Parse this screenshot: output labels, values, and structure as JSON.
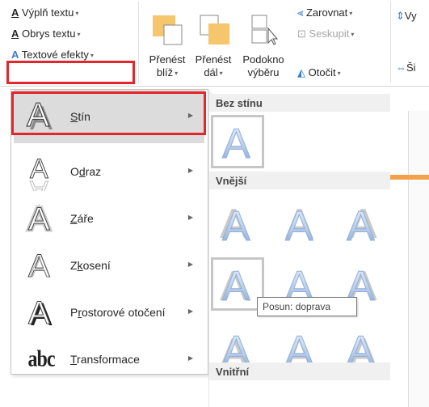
{
  "ribbon": {
    "fill_text": "Výplň textu",
    "outline_text": "Obrys textu",
    "text_effects": "Textové efekty",
    "bring_forward_1": "Přenést",
    "bring_forward_2": "blíž",
    "send_back_1": "Přenést",
    "send_back_2": "dál",
    "pane_1": "Podokno",
    "pane_2": "výběru",
    "align": "Zarovnat",
    "group": "Seskupit",
    "rotate": "Otočit",
    "cut_v": "Vy",
    "cut_s": "Ši"
  },
  "menu": {
    "items": [
      {
        "label": "Stín",
        "accel": "S",
        "rest": "tín"
      },
      {
        "label": "Odraz",
        "accel": "d",
        "pre": "O",
        "rest": "raz"
      },
      {
        "label": "Záře",
        "accel": "Z",
        "rest": "áře"
      },
      {
        "label": "Zkosení",
        "accel": "k",
        "pre": "Z",
        "rest": "osení"
      },
      {
        "label": "Prostorové otočení",
        "accel": "r",
        "pre": "P",
        "rest": "ostorové otočení"
      },
      {
        "label": "Transformace",
        "accel": "T",
        "rest": "ransformace"
      }
    ],
    "transform_icon_text": "abc"
  },
  "gallery": {
    "no_shadow": "Bez stínu",
    "outer": "Vnější",
    "inner": "Vnitřní",
    "tooltip": "Posun: doprava"
  },
  "colors": {
    "highlight": "#e3262b",
    "accent_orange": "#f4a14c"
  }
}
